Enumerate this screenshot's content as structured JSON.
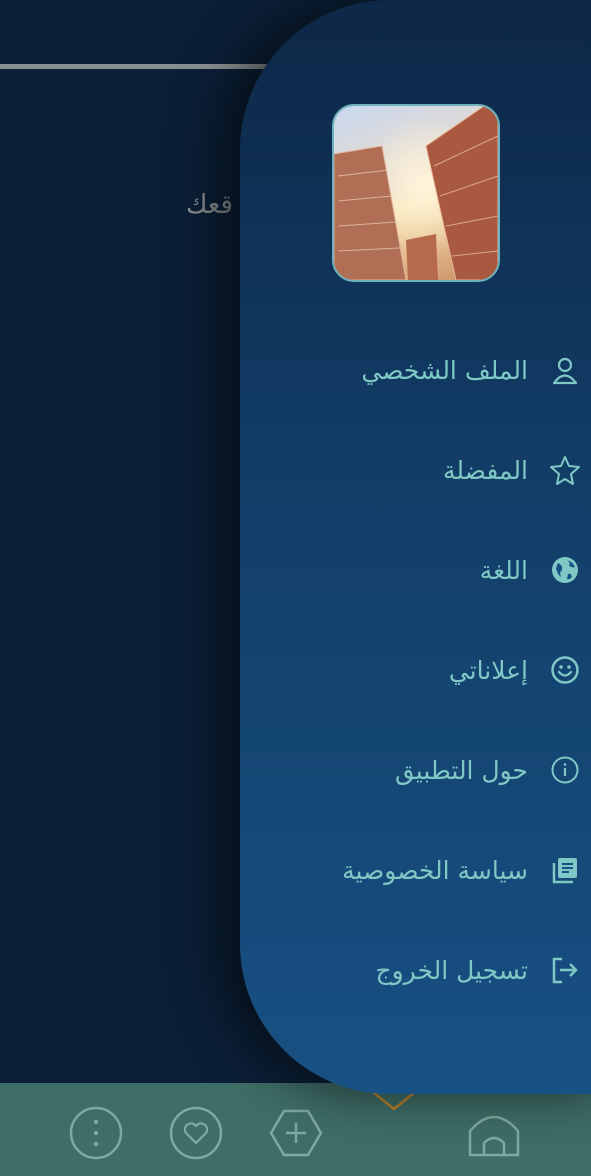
{
  "background": {
    "partial_text": "قعك"
  },
  "drawer": {
    "menu": [
      {
        "label": "الملف الشخصي",
        "icon": "user-icon"
      },
      {
        "label": "المفضلة",
        "icon": "star-icon"
      },
      {
        "label": "اللغة",
        "icon": "globe-icon"
      },
      {
        "label": "إعلاناتي",
        "icon": "smile-icon"
      },
      {
        "label": "حول التطبيق",
        "icon": "info-icon"
      },
      {
        "label": "سياسة الخصوصية",
        "icon": "document-icon"
      },
      {
        "label": "تسجيل الخروج",
        "icon": "logout-icon"
      }
    ]
  },
  "bottom_nav": {
    "items": [
      {
        "icon": "more-icon"
      },
      {
        "icon": "heart-icon"
      },
      {
        "icon": "plus-icon"
      },
      {
        "icon": "home-icon"
      }
    ]
  },
  "colors": {
    "drawer_top": "#0d2747",
    "drawer_bottom": "#185184",
    "accent": "#7fc8c6",
    "bottom_nav": "#3f6d67"
  }
}
